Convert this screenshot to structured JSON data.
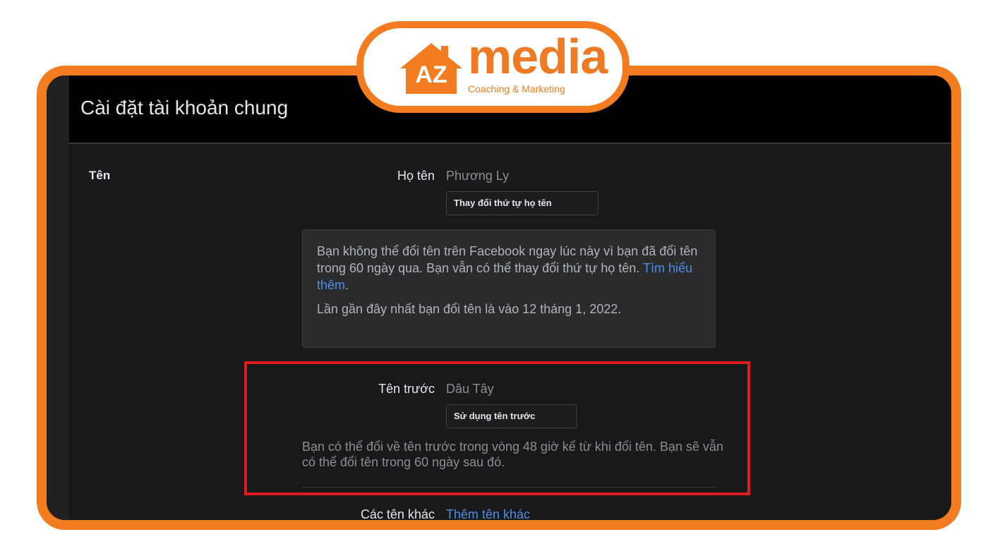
{
  "brand": {
    "mark_letters": "AZ",
    "word": "media",
    "tagline": "Coaching & Marketing",
    "accent": "#f47c20"
  },
  "header": {
    "title": "Cài đặt tài khoản chung",
    "top_right_text": ""
  },
  "name_section": {
    "label": "Tên",
    "full_name_label": "Họ tên",
    "full_name_value": "Phương Ly",
    "reorder_button": "Thay đổi thứ tự họ tên",
    "notice_line1_text": "Bạn không thể đổi tên trên Facebook ngay lúc này vì bạn đã đổi tên trong 60 ngày qua. Bạn vẫn có thể thay đổi thứ tự họ tên.",
    "notice_link": "Tìm hiểu thêm",
    "notice_line2": "Lần gần đây nhất bạn đổi tên là vào 12 tháng 1, 2022.",
    "previous_name_label": "Tên trước",
    "previous_name_value": "Dâu Tây",
    "use_previous_button": "Sử dụng tên trước",
    "previous_help": "Bạn có thể đổi về tên trước trong vòng 48 giờ kể từ khi đổi tên. Bạn sẽ vẫn có thể đổi tên trong 60 ngày sau đó.",
    "other_names_label": "Các tên khác",
    "other_names_link": "Thêm tên khác"
  },
  "highlight_color": "#e11b22"
}
